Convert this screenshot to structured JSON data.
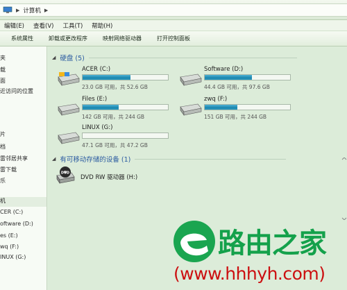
{
  "address": {
    "crumbs": [
      "计算机"
    ]
  },
  "menu": [
    "编辑(E)",
    "查看(V)",
    "工具(T)",
    "帮助(H)"
  ],
  "toolbar": [
    "系统属性",
    "卸载或更改程序",
    "映射网络驱动器",
    "打开控制面板"
  ],
  "sidebar": {
    "items": [
      "夹",
      "载",
      "面",
      "近访问的位置",
      "片",
      "档",
      "雷邻居共享",
      "雷下载",
      "乐",
      "机",
      "CER (C:)",
      "oftware (D:)",
      "es (E:)",
      "wq (F:)",
      "INUX (G:)"
    ]
  },
  "groups": {
    "hard_disks": "硬盘 (5)",
    "removable": "有可移动存储的设备 (1)"
  },
  "drives": [
    {
      "name": "ACER (C:)",
      "size": "23.0 GB 可用，共 52.6 GB",
      "used_fraction": 0.56
    },
    {
      "name": "Software (D:)",
      "size": "44.4 GB 可用，共 97.6 GB",
      "used_fraction": 0.55
    },
    {
      "name": "Files (E:)",
      "size": "142 GB 可用，共 244 GB",
      "used_fraction": 0.42
    },
    {
      "name": "zwq (F:)",
      "size": "151 GB 可用，共 244 GB",
      "used_fraction": 0.38
    },
    {
      "name": "LINUX (G:)",
      "size": "47.1 GB 可用，共 47.2 GB",
      "used_fraction": 0.0
    }
  ],
  "dvd": {
    "name": "DVD RW 驱动器 (H:)",
    "badge": "DVD"
  },
  "watermark": {
    "brand": "路由之家",
    "url": "(www.hhhyh.com)"
  },
  "colors": {
    "accent": "#2a5aa0",
    "bar_fill": "#1b86ad",
    "brand_green": "#14a14b",
    "url_red": "#cc0f10"
  }
}
